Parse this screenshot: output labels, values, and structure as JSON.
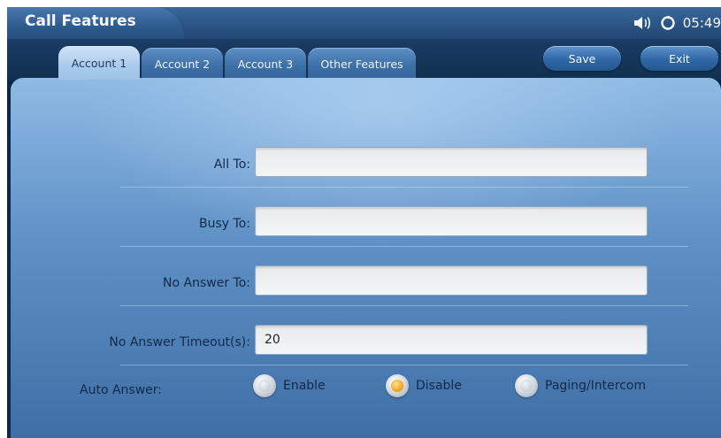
{
  "header": {
    "title": "Call Features",
    "volume_icon": "speaker-icon",
    "sync_icon": "circular-refresh-icon",
    "clock": "05:49"
  },
  "tabs": [
    {
      "label": "Account 1",
      "active": true
    },
    {
      "label": "Account 2",
      "active": false
    },
    {
      "label": "Account 3",
      "active": false
    },
    {
      "label": "Other Features",
      "active": false
    }
  ],
  "actions": {
    "save_label": "Save",
    "exit_label": "Exit"
  },
  "form": {
    "all_to": {
      "label": "All To:",
      "value": ""
    },
    "busy_to": {
      "label": "Busy To:",
      "value": ""
    },
    "no_answer_to": {
      "label": "No Answer To:",
      "value": ""
    },
    "no_answer_timeout": {
      "label": "No Answer Timeout(s):",
      "value": "20"
    },
    "auto_answer": {
      "label": "Auto Answer:",
      "options": [
        "Enable",
        "Disable",
        "Paging/Intercom"
      ],
      "selected": "Disable"
    }
  },
  "colors": {
    "accent": "#3d6fa6",
    "selected_radio": "#f5a623"
  }
}
